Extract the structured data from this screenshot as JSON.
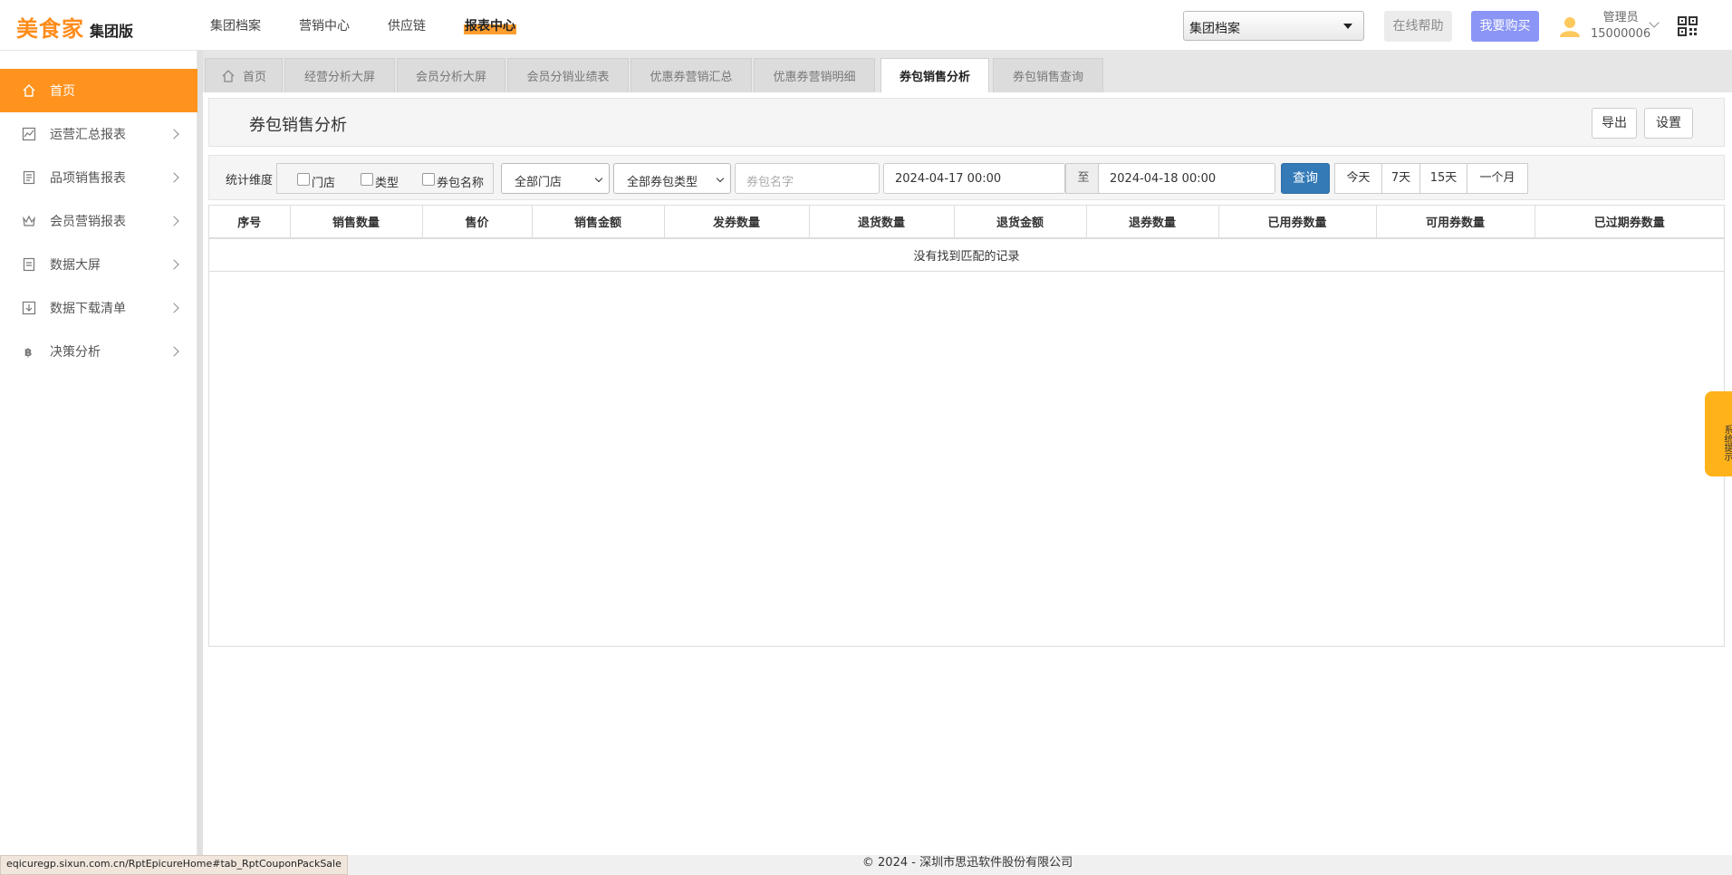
{
  "header": {
    "brand": "美食家",
    "edition": "集团版",
    "nav": [
      {
        "label": "集团档案"
      },
      {
        "label": "营销中心"
      },
      {
        "label": "供应链"
      },
      {
        "label": "报表中心"
      }
    ],
    "group_select_value": "集团档案",
    "help_label": "在线帮助",
    "buy_label": "我要购买",
    "user_role": "管理员",
    "user_id": "15000006"
  },
  "sidebar": {
    "items": [
      {
        "label": "首页"
      },
      {
        "label": "运营汇总报表"
      },
      {
        "label": "品项销售报表"
      },
      {
        "label": "会员营销报表"
      },
      {
        "label": "数据大屏"
      },
      {
        "label": "数据下载清单"
      },
      {
        "label": "决策分析"
      }
    ]
  },
  "tabs": [
    {
      "label": "首页"
    },
    {
      "label": "经营分析大屏"
    },
    {
      "label": "会员分析大屏"
    },
    {
      "label": "会员分销业绩表"
    },
    {
      "label": "优惠券营销汇总"
    },
    {
      "label": "优惠券营销明细"
    },
    {
      "label": "券包销售分析"
    },
    {
      "label": "券包销售查询"
    }
  ],
  "panel": {
    "title": "券包销售分析",
    "export_label": "导出",
    "settings_label": "设置"
  },
  "filters": {
    "dimension_label": "统计维度",
    "dimensions": [
      {
        "label": "门店"
      },
      {
        "label": "类型"
      },
      {
        "label": "券包名称"
      }
    ],
    "store_select": "全部门店",
    "type_select": "全部券包类型",
    "name_placeholder": "券包名字",
    "start_date": "2024-04-17 00:00",
    "to_label": "至",
    "end_date": "2024-04-18 00:00",
    "query_label": "查询",
    "quick_ranges": [
      "今天",
      "7天",
      "15天",
      "一个月"
    ]
  },
  "table": {
    "columns": [
      "序号",
      "销售数量",
      "售价",
      "销售金额",
      "发券数量",
      "退货数量",
      "退货金额",
      "退券数量",
      "已用券数量",
      "可用券数量",
      "已过期券数量"
    ],
    "empty_text": "没有找到匹配的记录"
  },
  "footer": {
    "copyright": "© 2024 - 深圳市思迅软件股份有限公司",
    "status_url": "eqicuregp.sixun.com.cn/RptEpicureHome#tab_RptCouponPackSale"
  },
  "side_tip": "系统提示",
  "colors": {
    "accent": "#ff931e",
    "primary": "#337ab7",
    "buy": "#8a95f5",
    "tip": "#ffb21a"
  }
}
